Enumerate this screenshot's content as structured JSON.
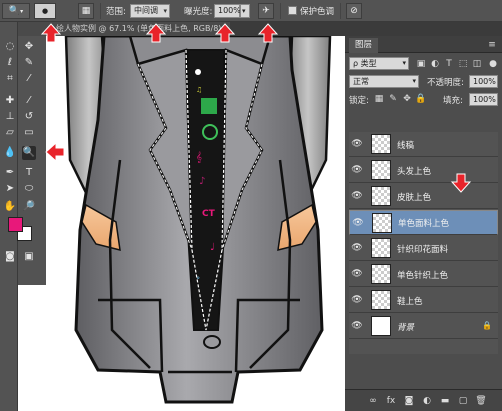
{
  "options_bar": {
    "range_label": "范围:",
    "range_value": "中间调",
    "exposure_label": "曝光度:",
    "exposure_value": "100%",
    "protect_tone_label": "保护色调"
  },
  "document": {
    "tab_title": "绘人物实例 @ 67.1% (单色面料上色, RGB/8)"
  },
  "layers_panel": {
    "tab_label": "图层",
    "filter_label": "ρ 类型",
    "blend_mode": "正常",
    "opacity_label": "不透明度:",
    "opacity_value": "100%",
    "lock_label": "锁定:",
    "fill_label": "填充:",
    "fill_value": "100%",
    "layers": [
      {
        "name": "线稿",
        "selected": false
      },
      {
        "name": "头发上色",
        "selected": false
      },
      {
        "name": "皮肤上色",
        "selected": false
      },
      {
        "name": "单色面料上色",
        "selected": true
      },
      {
        "name": "针织印花面料",
        "selected": false
      },
      {
        "name": "单色针织上色",
        "selected": false
      },
      {
        "name": "鞋上色",
        "selected": false
      },
      {
        "name": "背景",
        "selected": false,
        "locked": true
      }
    ]
  },
  "colors": {
    "foreground": "#e8187a",
    "background": "#ffffff",
    "selected_layer": "#6d8fb8",
    "annotation_arrow": "#e8232a"
  }
}
